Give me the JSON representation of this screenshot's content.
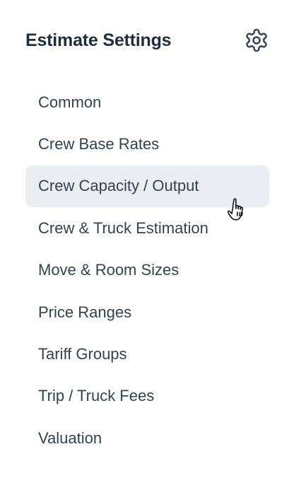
{
  "header": {
    "title": "Estimate Settings",
    "settings_icon": "gear-icon"
  },
  "menu": {
    "active_index": 2,
    "items": [
      {
        "label": "Common"
      },
      {
        "label": "Crew Base Rates"
      },
      {
        "label": "Crew Capacity / Output"
      },
      {
        "label": "Crew & Truck Estimation"
      },
      {
        "label": "Move & Room Sizes"
      },
      {
        "label": "Price Ranges"
      },
      {
        "label": "Tariff Groups"
      },
      {
        "label": "Trip / Truck Fees"
      },
      {
        "label": "Valuation"
      }
    ]
  },
  "colors": {
    "text": "#34414e",
    "title": "#1f2d3d",
    "active_background": "#eaeef3"
  },
  "cursor": "hand-pointer-icon"
}
